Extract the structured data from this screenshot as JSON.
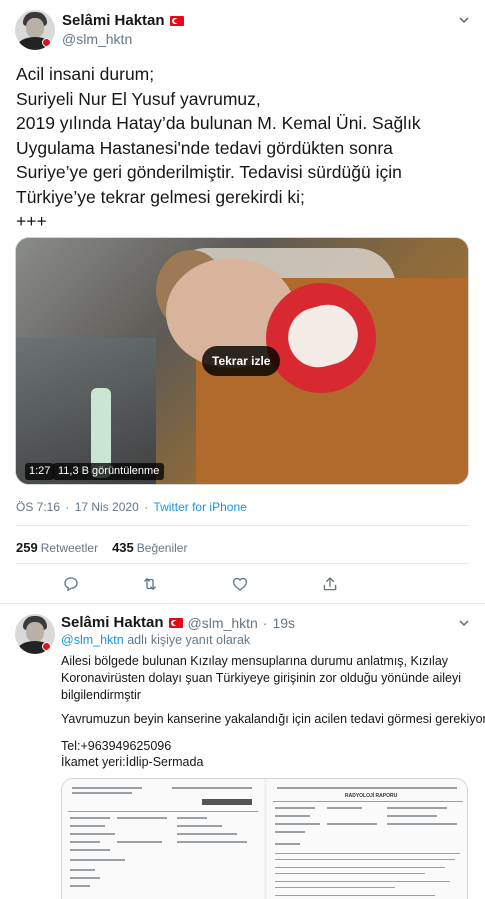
{
  "main_tweet": {
    "author": {
      "name": "Selâmi Haktan",
      "handle": "@slm_hktn"
    },
    "text_lines": [
      "Acil insani durum;",
      "Suriyeli Nur El Yusuf yavrumuz,",
      "2019 yılında Hatay’da bulunan M. Kemal Üni. Sağlık",
      "Uygulama Hastanesi'nde tedavi gördükten sonra",
      "Suriye’ye geri gönderilmiştir. Tedavisi sürdüğü için",
      "Türkiye’ye tekrar gelmesi gerekirdi ki;",
      "+++"
    ],
    "video": {
      "replay_label": "Tekrar izle",
      "duration": "1:27",
      "views": "11,3 B görüntülenme"
    },
    "time": "ÖS 7:16",
    "date": "17 Nis 2020",
    "source": "Twitter for iPhone",
    "retweets": {
      "count": "259",
      "label": "Retweetler"
    },
    "likes": {
      "count": "435",
      "label": "Beğeniler"
    },
    "icons": [
      "reply-icon",
      "retweet-icon",
      "like-icon",
      "share-icon"
    ]
  },
  "reply_tweet": {
    "author": {
      "name": "Selâmi Haktan",
      "handle": "@slm_hktn"
    },
    "time_ago": "19s",
    "replying_mention": "@slm_hktn",
    "replying_suffix": "adlı kişiye yanıt olarak",
    "text_lines": [
      "Ailesi bölgede bulunan Kızılay mensuplarına durumu anlatmış, Kızılay",
      "Koronavirüsten dolayı şuan Türkiyeye girişinin zor olduğu yönünde aileyi",
      "bilgilendirmştir",
      "",
      "Yavrumuzun beyin kanserine yakalandığı için acilen tedavi görmesi gerekiyor",
      "",
      "Tel:+963949625096",
      "İkamet yeri:İdlip-Sermada"
    ],
    "doc_right_title": "RADYOLOJİ RAPORU"
  }
}
